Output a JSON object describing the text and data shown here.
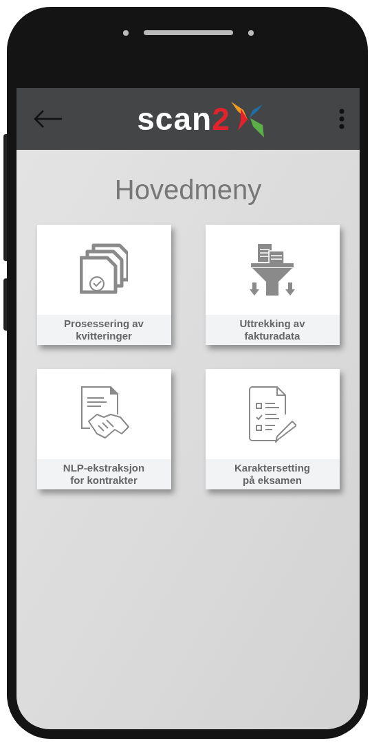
{
  "app_bar": {
    "logo_text": "scan",
    "logo_digit": "2"
  },
  "title": "Hovedmeny",
  "tiles": [
    {
      "kind": "receipts",
      "label": "Prosessering av\nkvitteringer"
    },
    {
      "kind": "extract",
      "label": "Uttrekking av\nfakturadata"
    },
    {
      "kind": "contract",
      "label": "NLP-ekstraksjon\nfor kontrakter"
    },
    {
      "kind": "grading",
      "label": "Karaktersetting\npå eksamen"
    }
  ]
}
